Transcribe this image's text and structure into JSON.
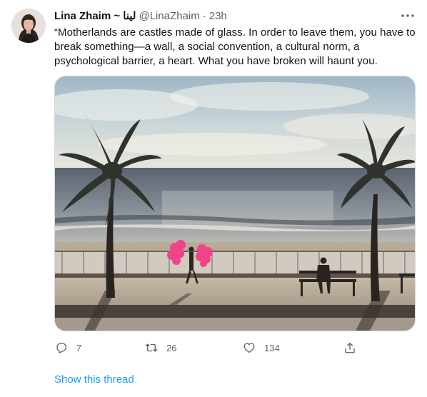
{
  "tweet": {
    "display_name": "Lina Zhaim ~ لينا",
    "handle": "@LinaZhaim",
    "separator": "·",
    "time": "23h",
    "text_lines": [
      "“Motherlands are castles made of glass. In order to leave them, you have to",
      "break something—a wall, a social convention, a cultural norm, a",
      "psychological barrier, a heart. What you have broken will haunt you."
    ],
    "media_description_icon": "photo",
    "actions": {
      "reply": {
        "icon": "reply-icon",
        "count": "7"
      },
      "retweet": {
        "icon": "retweet-icon",
        "count": "26"
      },
      "like": {
        "icon": "heart-icon",
        "count": "134"
      },
      "share": {
        "icon": "share-icon"
      }
    },
    "show_thread": "Show this thread"
  },
  "colors": {
    "text_primary": "#0f1419",
    "text_secondary": "#536471",
    "link": "#1d9bf0",
    "border": "#cfd9de"
  }
}
